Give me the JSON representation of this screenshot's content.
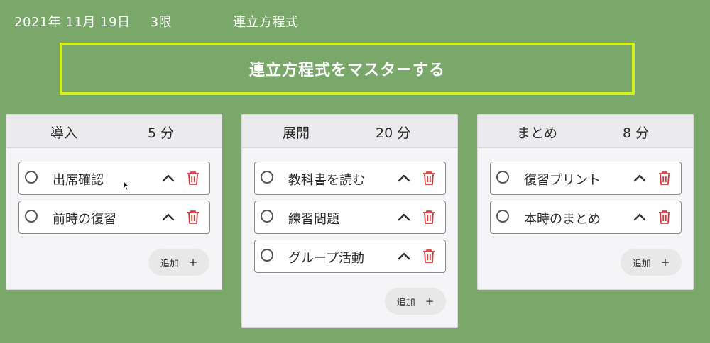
{
  "header": {
    "date": "2021年 11月 19日",
    "period": "3限",
    "subject": "連立方程式"
  },
  "goal": {
    "text": "連立方程式をマスターする"
  },
  "columns": [
    {
      "title": "導入",
      "minutes": "5 分",
      "items": [
        {
          "label": "出席確認"
        },
        {
          "label": "前時の復習"
        }
      ],
      "add_label": "追加",
      "add_icon": "+"
    },
    {
      "title": "展開",
      "minutes": "20 分",
      "items": [
        {
          "label": "教科書を読む"
        },
        {
          "label": "練習問題"
        },
        {
          "label": "グループ活動"
        }
      ],
      "add_label": "追加",
      "add_icon": "+"
    },
    {
      "title": "まとめ",
      "minutes": "8 分",
      "items": [
        {
          "label": "復習プリント"
        },
        {
          "label": "本時のまとめ"
        }
      ],
      "add_label": "追加",
      "add_icon": "+"
    }
  ],
  "colors": {
    "background": "#7aa86a",
    "goal_border": "#d8f01e",
    "trash": "#d23a3a"
  }
}
